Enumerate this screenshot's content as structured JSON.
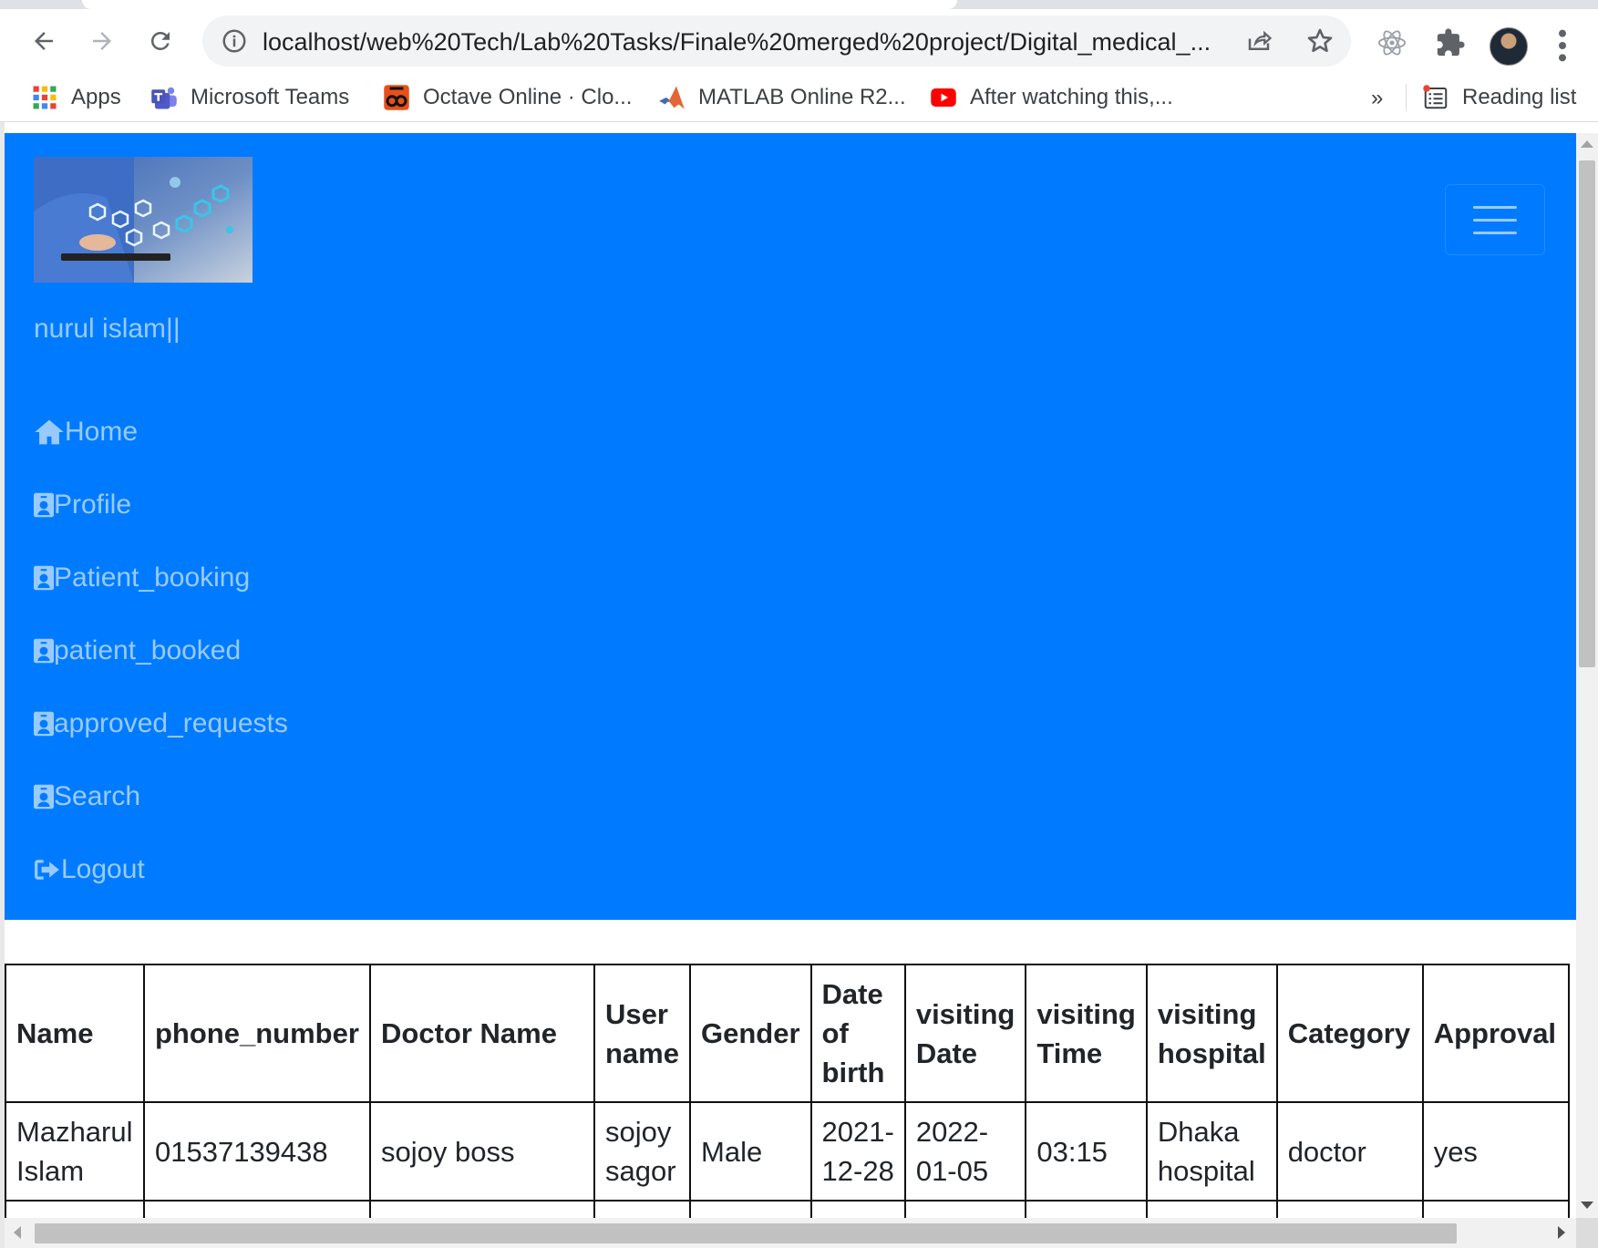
{
  "browser": {
    "url": "localhost/web%20Tech/Lab%20Tasks/Finale%20merged%20project/Digital_medical_...",
    "bookmarks": [
      {
        "label": "Apps",
        "icon": "apps-grid-icon"
      },
      {
        "label": "Microsoft Teams",
        "icon": "teams-icon"
      },
      {
        "label": "Octave Online · Clo...",
        "icon": "octave-icon"
      },
      {
        "label": "MATLAB Online R2...",
        "icon": "matlab-icon"
      },
      {
        "label": "After watching this,...",
        "icon": "youtube-icon"
      }
    ],
    "more_bookmarks": "»",
    "reading_list": "Reading list"
  },
  "nav": {
    "username": "nurul islam||",
    "items": [
      {
        "label": "Home",
        "icon": "home-icon"
      },
      {
        "label": "Profile",
        "icon": "id-badge-icon"
      },
      {
        "label": "Patient_booking",
        "icon": "id-badge-icon"
      },
      {
        "label": "patient_booked",
        "icon": "id-badge-icon"
      },
      {
        "label": "approved_requests",
        "icon": "id-badge-icon"
      },
      {
        "label": "Search",
        "icon": "id-badge-icon"
      },
      {
        "label": "Logout",
        "icon": "sign-out-icon"
      }
    ],
    "color": "#007bff"
  },
  "table": {
    "headers": [
      "Name",
      "phone_number",
      "Doctor Name",
      "User name",
      "Gender",
      "Date of birth",
      "visiting Date",
      "visiting Time",
      "visiting hospital",
      "Category",
      "Approval"
    ],
    "rows": [
      [
        "Mazharul Islam",
        "01537139438",
        "sojoy boss",
        "sojoy sagor",
        "Male",
        "2021-12-28",
        "2022-01-05",
        "03:15",
        "Dhaka hospital",
        "doctor",
        "yes"
      ]
    ]
  }
}
